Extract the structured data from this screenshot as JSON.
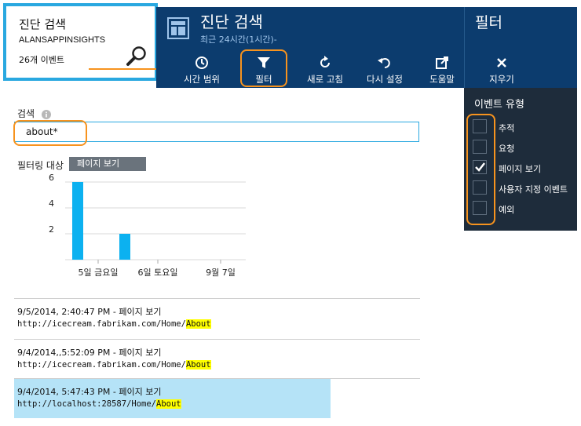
{
  "tile": {
    "title": "진단 검색",
    "app_name": "ALANSAPPINSIGHTS",
    "event_count": "26개 이벤트"
  },
  "blade": {
    "title": "진단 검색",
    "subtitle": "최근 24시간(1시간)-",
    "toolbar": [
      {
        "label": "시간 범위",
        "icon": "clock-icon"
      },
      {
        "label": "필터",
        "icon": "funnel-icon"
      },
      {
        "label": "새로 고침",
        "icon": "refresh-icon"
      },
      {
        "label": "다시 설정",
        "icon": "undo-icon"
      },
      {
        "label": "도움말",
        "icon": "external-link-icon"
      }
    ]
  },
  "filter_panel": {
    "title": "필터",
    "clear_label": "지우기",
    "event_type_label": "이벤트 유형",
    "event_types": [
      {
        "label": "추적",
        "checked": false
      },
      {
        "label": "요청",
        "checked": false
      },
      {
        "label": "페이지 보기",
        "checked": true
      },
      {
        "label": "사용자 지정 이벤트",
        "checked": false
      },
      {
        "label": "예외",
        "checked": false
      }
    ]
  },
  "search": {
    "label": "검색",
    "value": "about*"
  },
  "filter_target": {
    "label": "필터링 대상",
    "badge": "페이지 보기"
  },
  "chart_data": {
    "type": "bar",
    "categories": [
      "5일 금요일",
      "6일 토요일",
      "9월 7일"
    ],
    "yticks": [
      "2",
      "4",
      "6"
    ],
    "ylim": [
      0,
      6
    ],
    "values": [
      6,
      2
    ],
    "bar_color": "#0cb1f0"
  },
  "results": [
    {
      "line1": "9/5/2014, 2:40:47 PM - 페이지 보기",
      "url_prefix": "http://icecream.fabrikam.com/Home/",
      "url_highlight": "About",
      "selected": false
    },
    {
      "line1": "9/4/2014,,5:52:09 PM - 페이지 보기",
      "url_prefix": "http://icecream.fabrikam.com/Home/",
      "url_highlight": "About",
      "selected": false
    },
    {
      "line1": "9/4/2014, 5:47:43 PM - 페이지 보기",
      "url_prefix": "http://localhost:28587/Home/",
      "url_highlight": "About",
      "selected": true
    }
  ],
  "colors": {
    "header_bg": "#0c3c6e",
    "filter_panel_bg": "#1e2c3b",
    "tile_border": "#29a8e0",
    "callout": "#f7931e",
    "selected_row": "#b5e3f7",
    "highlight": "#ffff00"
  }
}
